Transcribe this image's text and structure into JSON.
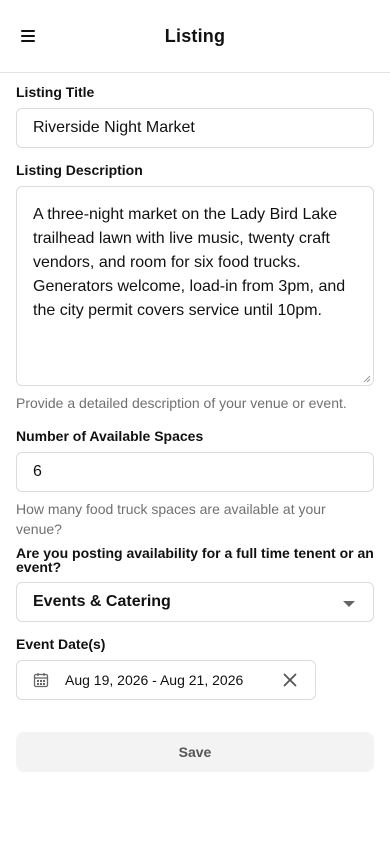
{
  "header": {
    "title": "Listing",
    "menu_icon": "hamburger-menu-icon"
  },
  "form": {
    "listing_title": {
      "label": "Listing Title",
      "value": "Riverside Night Market"
    },
    "listing_description": {
      "label": "Listing Description",
      "value": "A three-night market on the Lady Bird Lake trailhead lawn with live music, twenty craft vendors, and room for six food trucks. Generators welcome, load-in from 3pm, and the city permit covers service until 10pm.",
      "help": "Provide a detailed description of your venue or event."
    },
    "available_spaces": {
      "label": "Number of Available Spaces",
      "value": "6",
      "help": "How many food truck spaces are available at your venue?"
    },
    "posting_type": {
      "label": "Are you posting availability for a full time tenent or an event?",
      "selected": "Events & Catering"
    },
    "event_dates": {
      "label": "Event Date(s)",
      "value": "Aug 19, 2026 - Aug 21, 2026",
      "calendar_icon": "calendar-icon",
      "clear_icon": "close-icon"
    },
    "save_label": "Save"
  },
  "colors": {
    "border": "#dcdcdc",
    "help_text": "#707070",
    "save_bg": "#f3f3f3"
  }
}
